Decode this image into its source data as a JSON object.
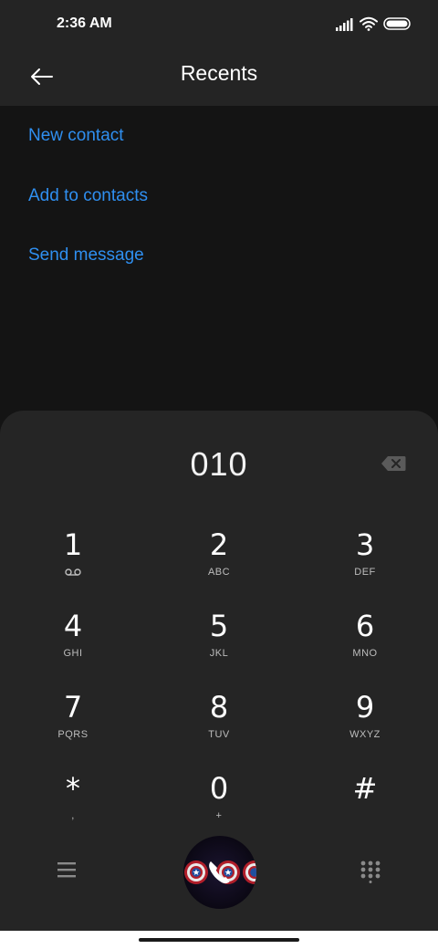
{
  "status_bar": {
    "time": "2:36 AM",
    "icons": [
      "signal-icon",
      "wifi-icon",
      "battery-icon"
    ]
  },
  "header": {
    "title": "Recents",
    "back_icon": "back-arrow-icon"
  },
  "actions": [
    {
      "label": "New contact"
    },
    {
      "label": "Add to contacts"
    },
    {
      "label": "Send message"
    }
  ],
  "dialpad": {
    "number": "010",
    "keys": [
      {
        "digit": "1",
        "letters": "",
        "sub_icon": "voicemail-icon"
      },
      {
        "digit": "2",
        "letters": "ABC"
      },
      {
        "digit": "3",
        "letters": "DEF"
      },
      {
        "digit": "4",
        "letters": "GHI"
      },
      {
        "digit": "5",
        "letters": "JKL"
      },
      {
        "digit": "6",
        "letters": "MNO"
      },
      {
        "digit": "7",
        "letters": "PQRS"
      },
      {
        "digit": "8",
        "letters": "TUV"
      },
      {
        "digit": "9",
        "letters": "WXYZ"
      },
      {
        "digit": "*",
        "letters": ","
      },
      {
        "digit": "0",
        "letters": "+"
      },
      {
        "digit": "#",
        "letters": ""
      }
    ]
  },
  "bottom_bar": {
    "menu_icon": "menu-icon",
    "call_icon": "phone-call-icon",
    "keypad_icon": "dialpad-grid-icon"
  },
  "colors": {
    "background": "#141414",
    "header": "#242424",
    "sheet": "#252525",
    "accent": "#2f8ff0",
    "text_secondary": "#bdbdbd"
  }
}
